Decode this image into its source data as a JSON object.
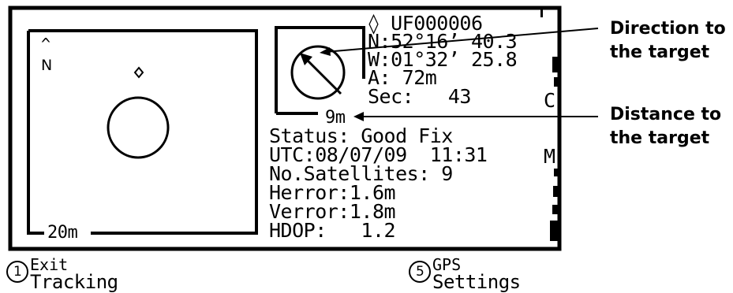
{
  "map": {
    "north_caret": "^",
    "north_label": "N",
    "scale_label": "20m"
  },
  "compass": {
    "distance_label": "9m"
  },
  "target": {
    "id": "◊ UF000006",
    "latitude": "N:52°16’ 40.3",
    "longitude": "W:01°32’ 25.8",
    "altitude": "A: 72m",
    "seconds": "Sec:   43"
  },
  "status": {
    "status_line": "Status: Good Fix",
    "utc_line": "UTC:08/07/09  11:31",
    "satellites_line": "No.Satellites: 9",
    "herror_line": "Herror:1.6m",
    "verror_line": "Verror:1.8m",
    "hdop_line": "HDOP:   1.2"
  },
  "side_letters": {
    "upper": "C",
    "lower": "M"
  },
  "softkeys": {
    "left_number": "1",
    "left_line1": "Exit",
    "left_line2": "Tracking",
    "right_number": "5",
    "right_line1": "GPS",
    "right_line2": "Settings"
  },
  "callouts": {
    "direction_line1": "Direction to",
    "direction_line2": "the target",
    "distance_line1": "Distance to",
    "distance_line2": "the target"
  },
  "colors": {
    "ink": "#000000",
    "background": "#ffffff"
  }
}
